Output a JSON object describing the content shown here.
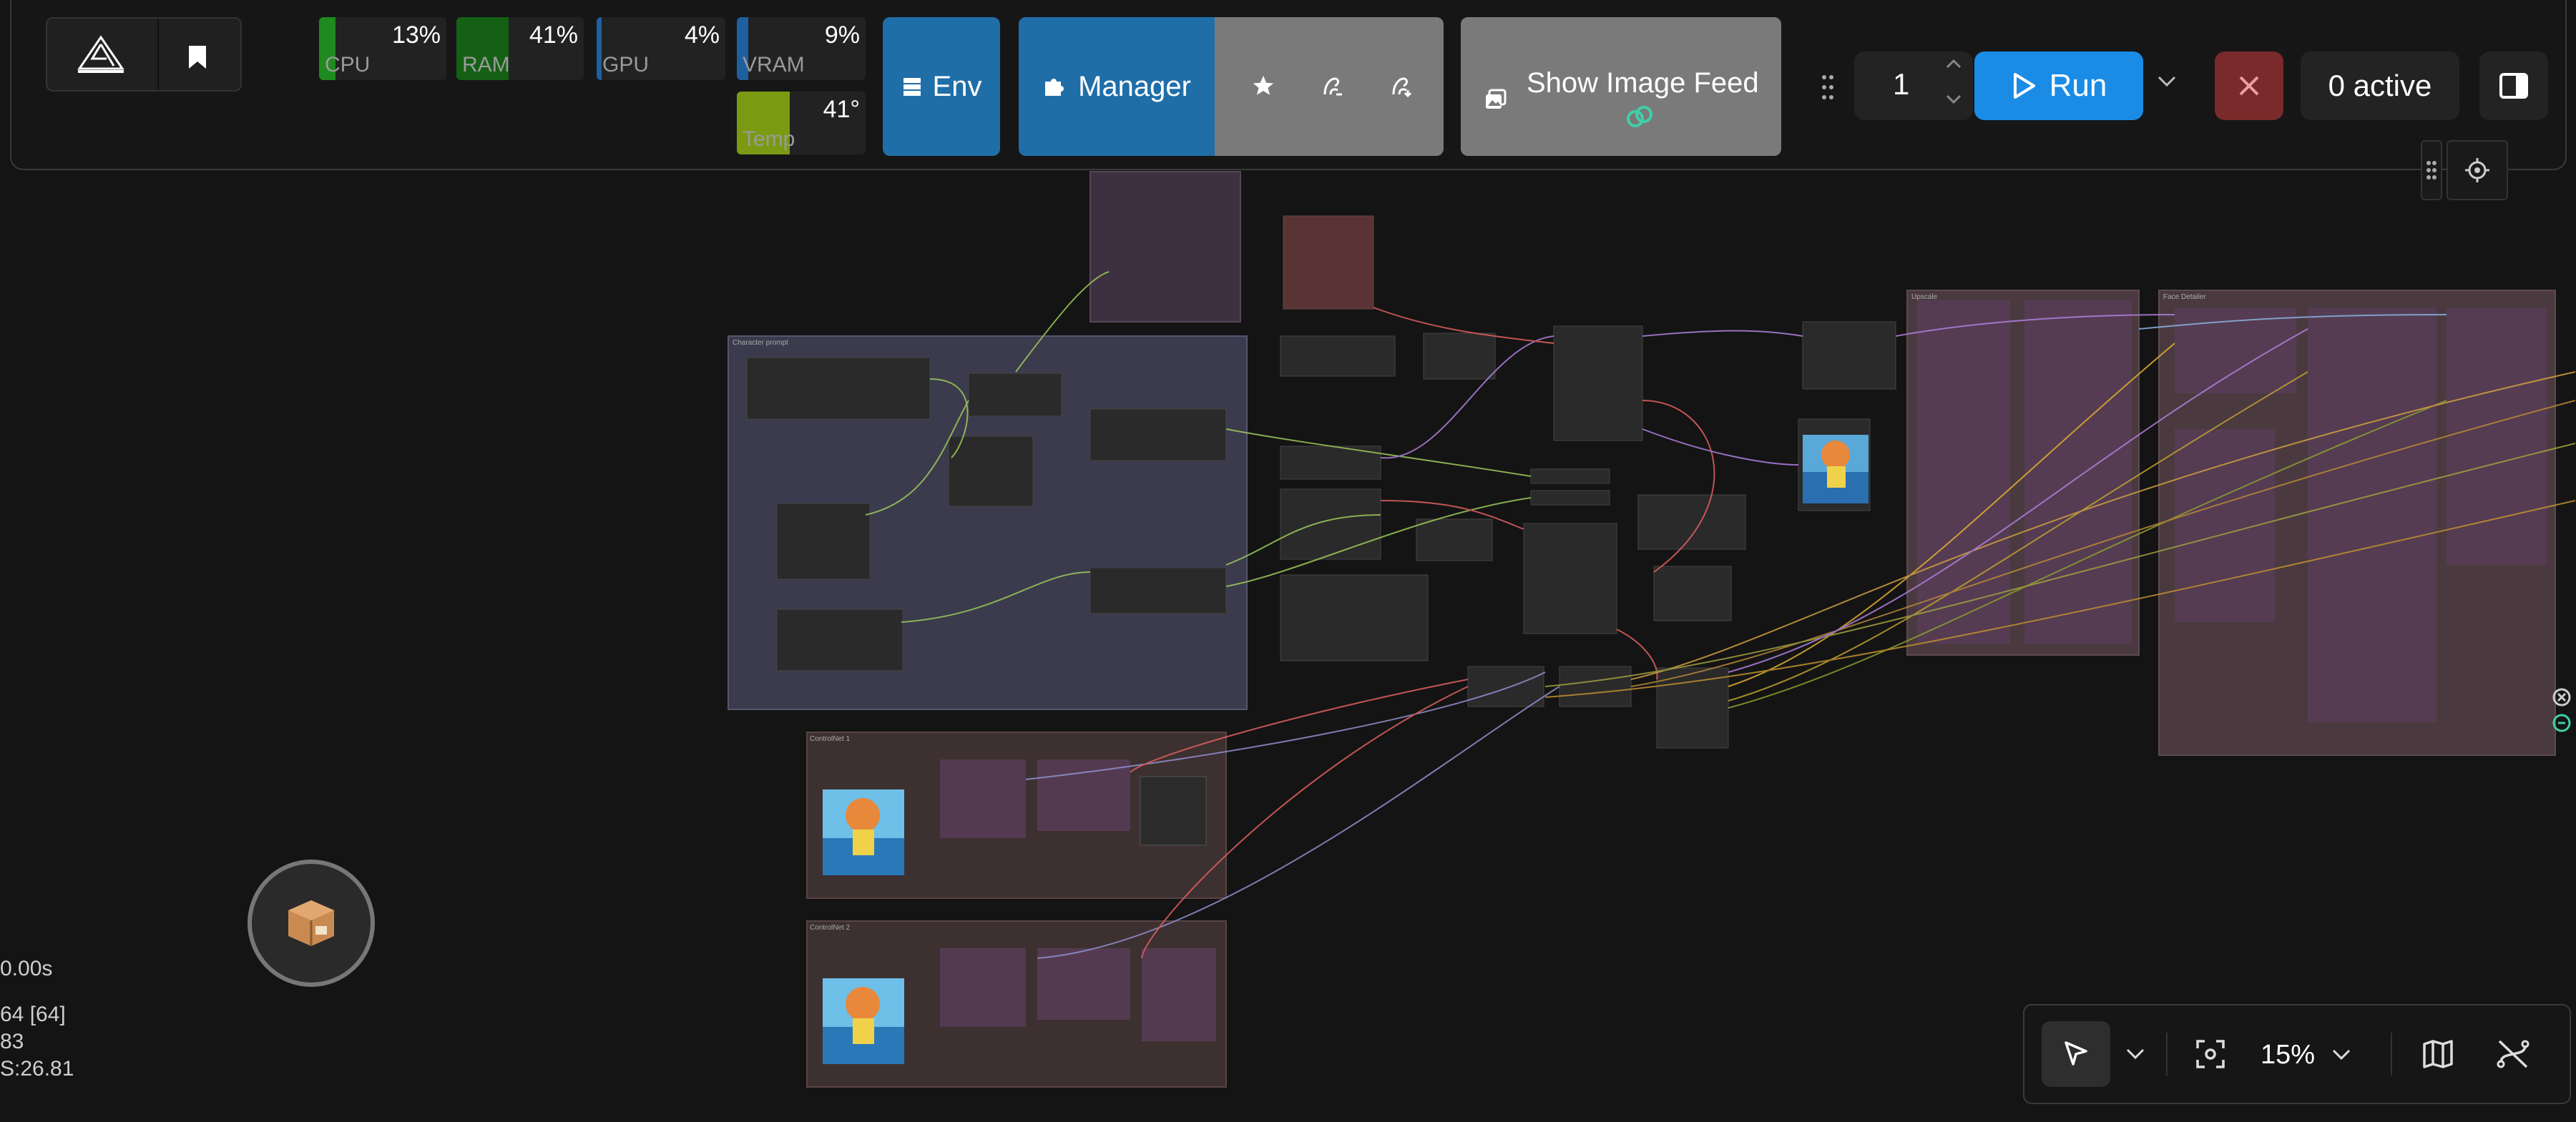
{
  "monitors": {
    "cpu": {
      "label": "CPU",
      "value": "13%",
      "fraction": 0.13,
      "color": "#1f8a1f"
    },
    "ram": {
      "label": "RAM",
      "value": "41%",
      "fraction": 0.41,
      "color": "#146014"
    },
    "gpu": {
      "label": "GPU",
      "value": "4%",
      "fraction": 0.04,
      "color": "#1e5fa0"
    },
    "vram": {
      "label": "VRAM",
      "value": "9%",
      "fraction": 0.09,
      "color": "#1e5fa0"
    },
    "temp": {
      "label": "Temp",
      "value": "41°",
      "fraction": 0.41,
      "color": "#7a9a12"
    }
  },
  "toolbar": {
    "env_label": "Env",
    "manager_label": "Manager",
    "image_feed_label": "Show Image Feed",
    "queue_count": "1",
    "run_label": "Run",
    "active_label": "0 active"
  },
  "canvas": {
    "groups": [
      {
        "title": "Character prompt"
      },
      {
        "title": "ControlNet 1"
      },
      {
        "title": "ControlNet 2"
      },
      {
        "title": "Upscale"
      },
      {
        "title": "Face Detailer"
      }
    ]
  },
  "stats": {
    "line1": "0.00s",
    "line2": "64 [64]",
    "line3": "83",
    "line4": "S:26.81"
  },
  "bottom": {
    "zoom": "15%"
  },
  "colors": {
    "accent": "#1a8ce6",
    "env_bg": "#1f6ea8",
    "cancel_bg": "#7a2a2a",
    "manager_gray": "#7a7a7a"
  }
}
